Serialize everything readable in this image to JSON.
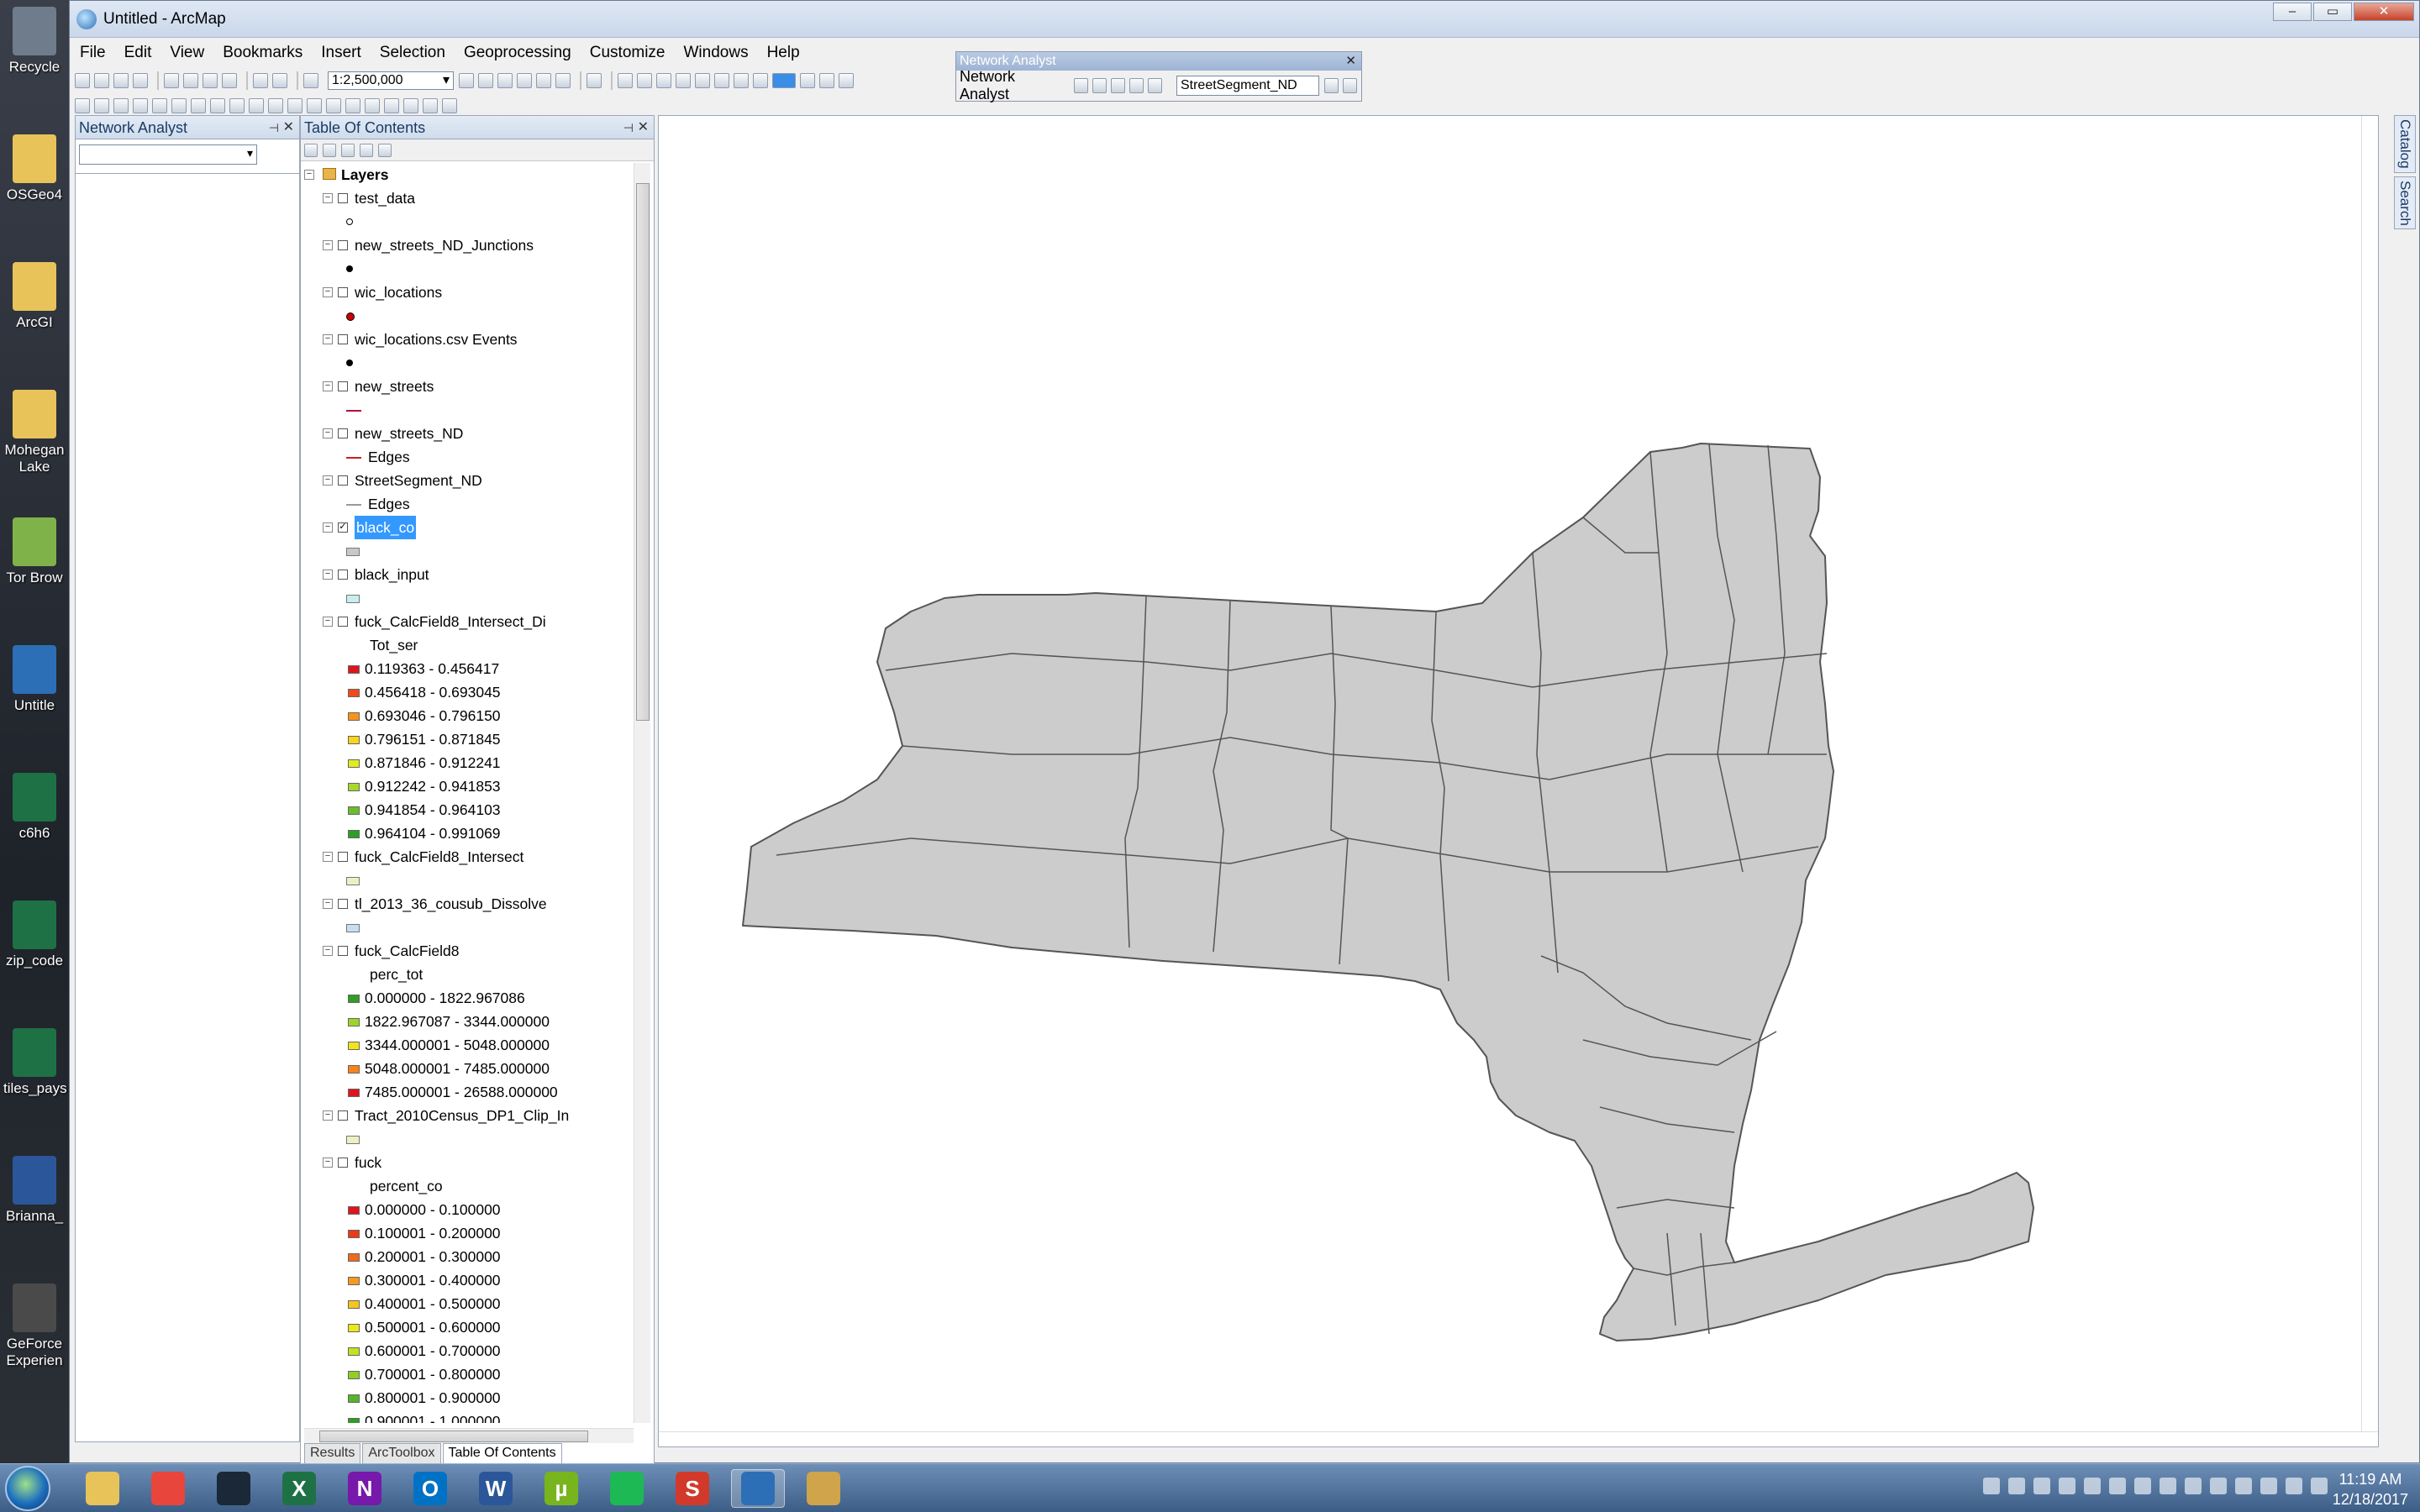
{
  "desktop": {
    "icons": [
      {
        "label": "Recycle",
        "icon": "recycle-bin-icon",
        "color": "#6f7c8c"
      },
      {
        "label": "OSGeo4",
        "icon": "folder-icon",
        "color": "#e7c35a"
      },
      {
        "label": "ArcGI",
        "icon": "folder-icon",
        "color": "#e7c35a"
      },
      {
        "label": "Mohegan Lake",
        "icon": "folder-icon",
        "color": "#e7c35a"
      },
      {
        "label": "Tor Brow",
        "icon": "folder-icon",
        "color": "#7fb34a"
      },
      {
        "label": "Untitle",
        "icon": "arcmap-document-icon",
        "color": "#2c6fb6"
      },
      {
        "label": "c6h6",
        "icon": "excel-file-icon",
        "color": "#1e7145"
      },
      {
        "label": "zip_code",
        "icon": "excel-file-icon",
        "color": "#1e7145"
      },
      {
        "label": "tiles_pays",
        "icon": "excel-file-icon",
        "color": "#1e7145"
      },
      {
        "label": "Brianna_",
        "icon": "word-file-icon",
        "color": "#2b579a"
      },
      {
        "label": "GeForce Experien",
        "icon": "geforce-icon",
        "color": "#4a4a4a"
      }
    ]
  },
  "window": {
    "title": "Untitled - ArcMap",
    "controls": [
      "–",
      "▭",
      "✕"
    ]
  },
  "menu": [
    "File",
    "Edit",
    "View",
    "Bookmarks",
    "Insert",
    "Selection",
    "Geoprocessing",
    "Customize",
    "Windows",
    "Help"
  ],
  "toolbar": {
    "scale": "1:2,500,000"
  },
  "na_toolbar": {
    "title": "Network Analyst",
    "dropdown_label": "Network Analyst",
    "network_combo": "StreetSegment_ND"
  },
  "na_panel": {
    "title": "Network Analyst"
  },
  "toc": {
    "title": "Table Of Contents",
    "root": "Layers",
    "layers": [
      {
        "name": "test_data",
        "checked": false,
        "symbol": "dot"
      },
      {
        "name": "new_streets_ND_Junctions",
        "checked": false,
        "symbol": "dotfill"
      },
      {
        "name": "wic_locations",
        "checked": false,
        "symbol": "dotred"
      },
      {
        "name": "wic_locations.csv Events",
        "checked": false,
        "symbol": "dotfill"
      },
      {
        "name": "new_streets",
        "checked": false,
        "symbol": "line",
        "symcolor": "#b0103a"
      },
      {
        "name": "new_streets_ND",
        "checked": false,
        "symbol": "line",
        "symcolor": "#c82020",
        "sublabel": "Edges"
      },
      {
        "name": "StreetSegment_ND",
        "checked": false,
        "symbol": "line",
        "symcolor": "#9a9a9a",
        "sublabel": "Edges"
      },
      {
        "name": "black_co",
        "checked": true,
        "selected": true,
        "symbol": "rect",
        "symcolor": "#c8c8c8"
      },
      {
        "name": "black_input",
        "checked": false,
        "symbol": "rect",
        "symcolor": "#c9eeee"
      },
      {
        "name": "fuck_CalcField8_Intersect_Di",
        "checked": false,
        "field": "Tot_ser",
        "classes": [
          {
            "label": "0.119363 - 0.456417",
            "color": "#e0141c"
          },
          {
            "label": "0.456418 - 0.693045",
            "color": "#f04a1a"
          },
          {
            "label": "0.693046 - 0.796150",
            "color": "#f5941c"
          },
          {
            "label": "0.796151 - 0.871845",
            "color": "#f7d51a"
          },
          {
            "label": "0.871846 - 0.912241",
            "color": "#e2ec1e"
          },
          {
            "label": "0.912242 - 0.941853",
            "color": "#a6d92a"
          },
          {
            "label": "0.941854 - 0.964103",
            "color": "#68bf2a"
          },
          {
            "label": "0.964104 - 0.991069",
            "color": "#2f9e24"
          }
        ]
      },
      {
        "name": "fuck_CalcField8_Intersect",
        "checked": false,
        "symbol": "rect",
        "symcolor": "#eef0c4"
      },
      {
        "name": "tl_2013_36_cousub_Dissolve",
        "checked": false,
        "symbol": "rect",
        "symcolor": "#c6def3"
      },
      {
        "name": "fuck_CalcField8",
        "checked": false,
        "field": "perc_tot",
        "classes": [
          {
            "label": "0.000000 - 1822.967086",
            "color": "#2f9e24"
          },
          {
            "label": "1822.967087 - 3344.000000",
            "color": "#9ed42a"
          },
          {
            "label": "3344.000001 - 5048.000000",
            "color": "#f3e41a"
          },
          {
            "label": "5048.000001 - 7485.000000",
            "color": "#f5841c"
          },
          {
            "label": "7485.000001 - 26588.000000",
            "color": "#e0141c"
          }
        ]
      },
      {
        "name": "Tract_2010Census_DP1_Clip_In",
        "checked": false,
        "symbol": "rect",
        "symcolor": "#eef0c4"
      },
      {
        "name": "fuck",
        "checked": false,
        "field": "percent_co",
        "classes": [
          {
            "label": "0.000000 - 0.100000",
            "color": "#e0141c"
          },
          {
            "label": "0.100001 - 0.200000",
            "color": "#ea3a1a"
          },
          {
            "label": "0.200001 - 0.300000",
            "color": "#f06a1a"
          },
          {
            "label": "0.300001 - 0.400000",
            "color": "#f59a1c"
          },
          {
            "label": "0.400001 - 0.500000",
            "color": "#f7c61a"
          },
          {
            "label": "0.500001 - 0.600000",
            "color": "#eee61a"
          },
          {
            "label": "0.600001 - 0.700000",
            "color": "#c6e21e"
          },
          {
            "label": "0.700001 - 0.800000",
            "color": "#8fcf26"
          },
          {
            "label": "0.800001 - 0.900000",
            "color": "#55b526"
          },
          {
            "label": "0.900001 - 1.000000",
            "color": "#2f9e24"
          }
        ]
      }
    ],
    "tabs": [
      "Results",
      "ArcToolbox",
      "Table Of Contents"
    ]
  },
  "side_tabs": [
    "Catalog",
    "Search"
  ],
  "taskbar": {
    "apps": [
      {
        "name": "file-explorer-icon",
        "label": "",
        "color": "#e7c35a"
      },
      {
        "name": "chrome-icon",
        "label": "",
        "color": "#e8453c"
      },
      {
        "name": "steam-icon",
        "label": "",
        "color": "#1b2838"
      },
      {
        "name": "excel-icon",
        "label": "X",
        "color": "#1e7145"
      },
      {
        "name": "onenote-icon",
        "label": "N",
        "color": "#7719aa"
      },
      {
        "name": "outlook-icon",
        "label": "O",
        "color": "#0072c6"
      },
      {
        "name": "word-icon",
        "label": "W",
        "color": "#2b579a"
      },
      {
        "name": "utorrent-icon",
        "label": "µ",
        "color": "#78b41e"
      },
      {
        "name": "spotify-icon",
        "label": "",
        "color": "#1db954"
      },
      {
        "name": "sketch-s-icon",
        "label": "S",
        "color": "#d13a2a"
      },
      {
        "name": "arcmap-icon",
        "label": "",
        "color": "#2c6fb6"
      },
      {
        "name": "paint-icon",
        "label": "",
        "color": "#cfa44a"
      }
    ],
    "time": "11:19 AM",
    "date": "12/18/2017"
  },
  "map": {
    "background": "#ffffff",
    "fill": "#cccccc",
    "stroke": "#555555"
  }
}
